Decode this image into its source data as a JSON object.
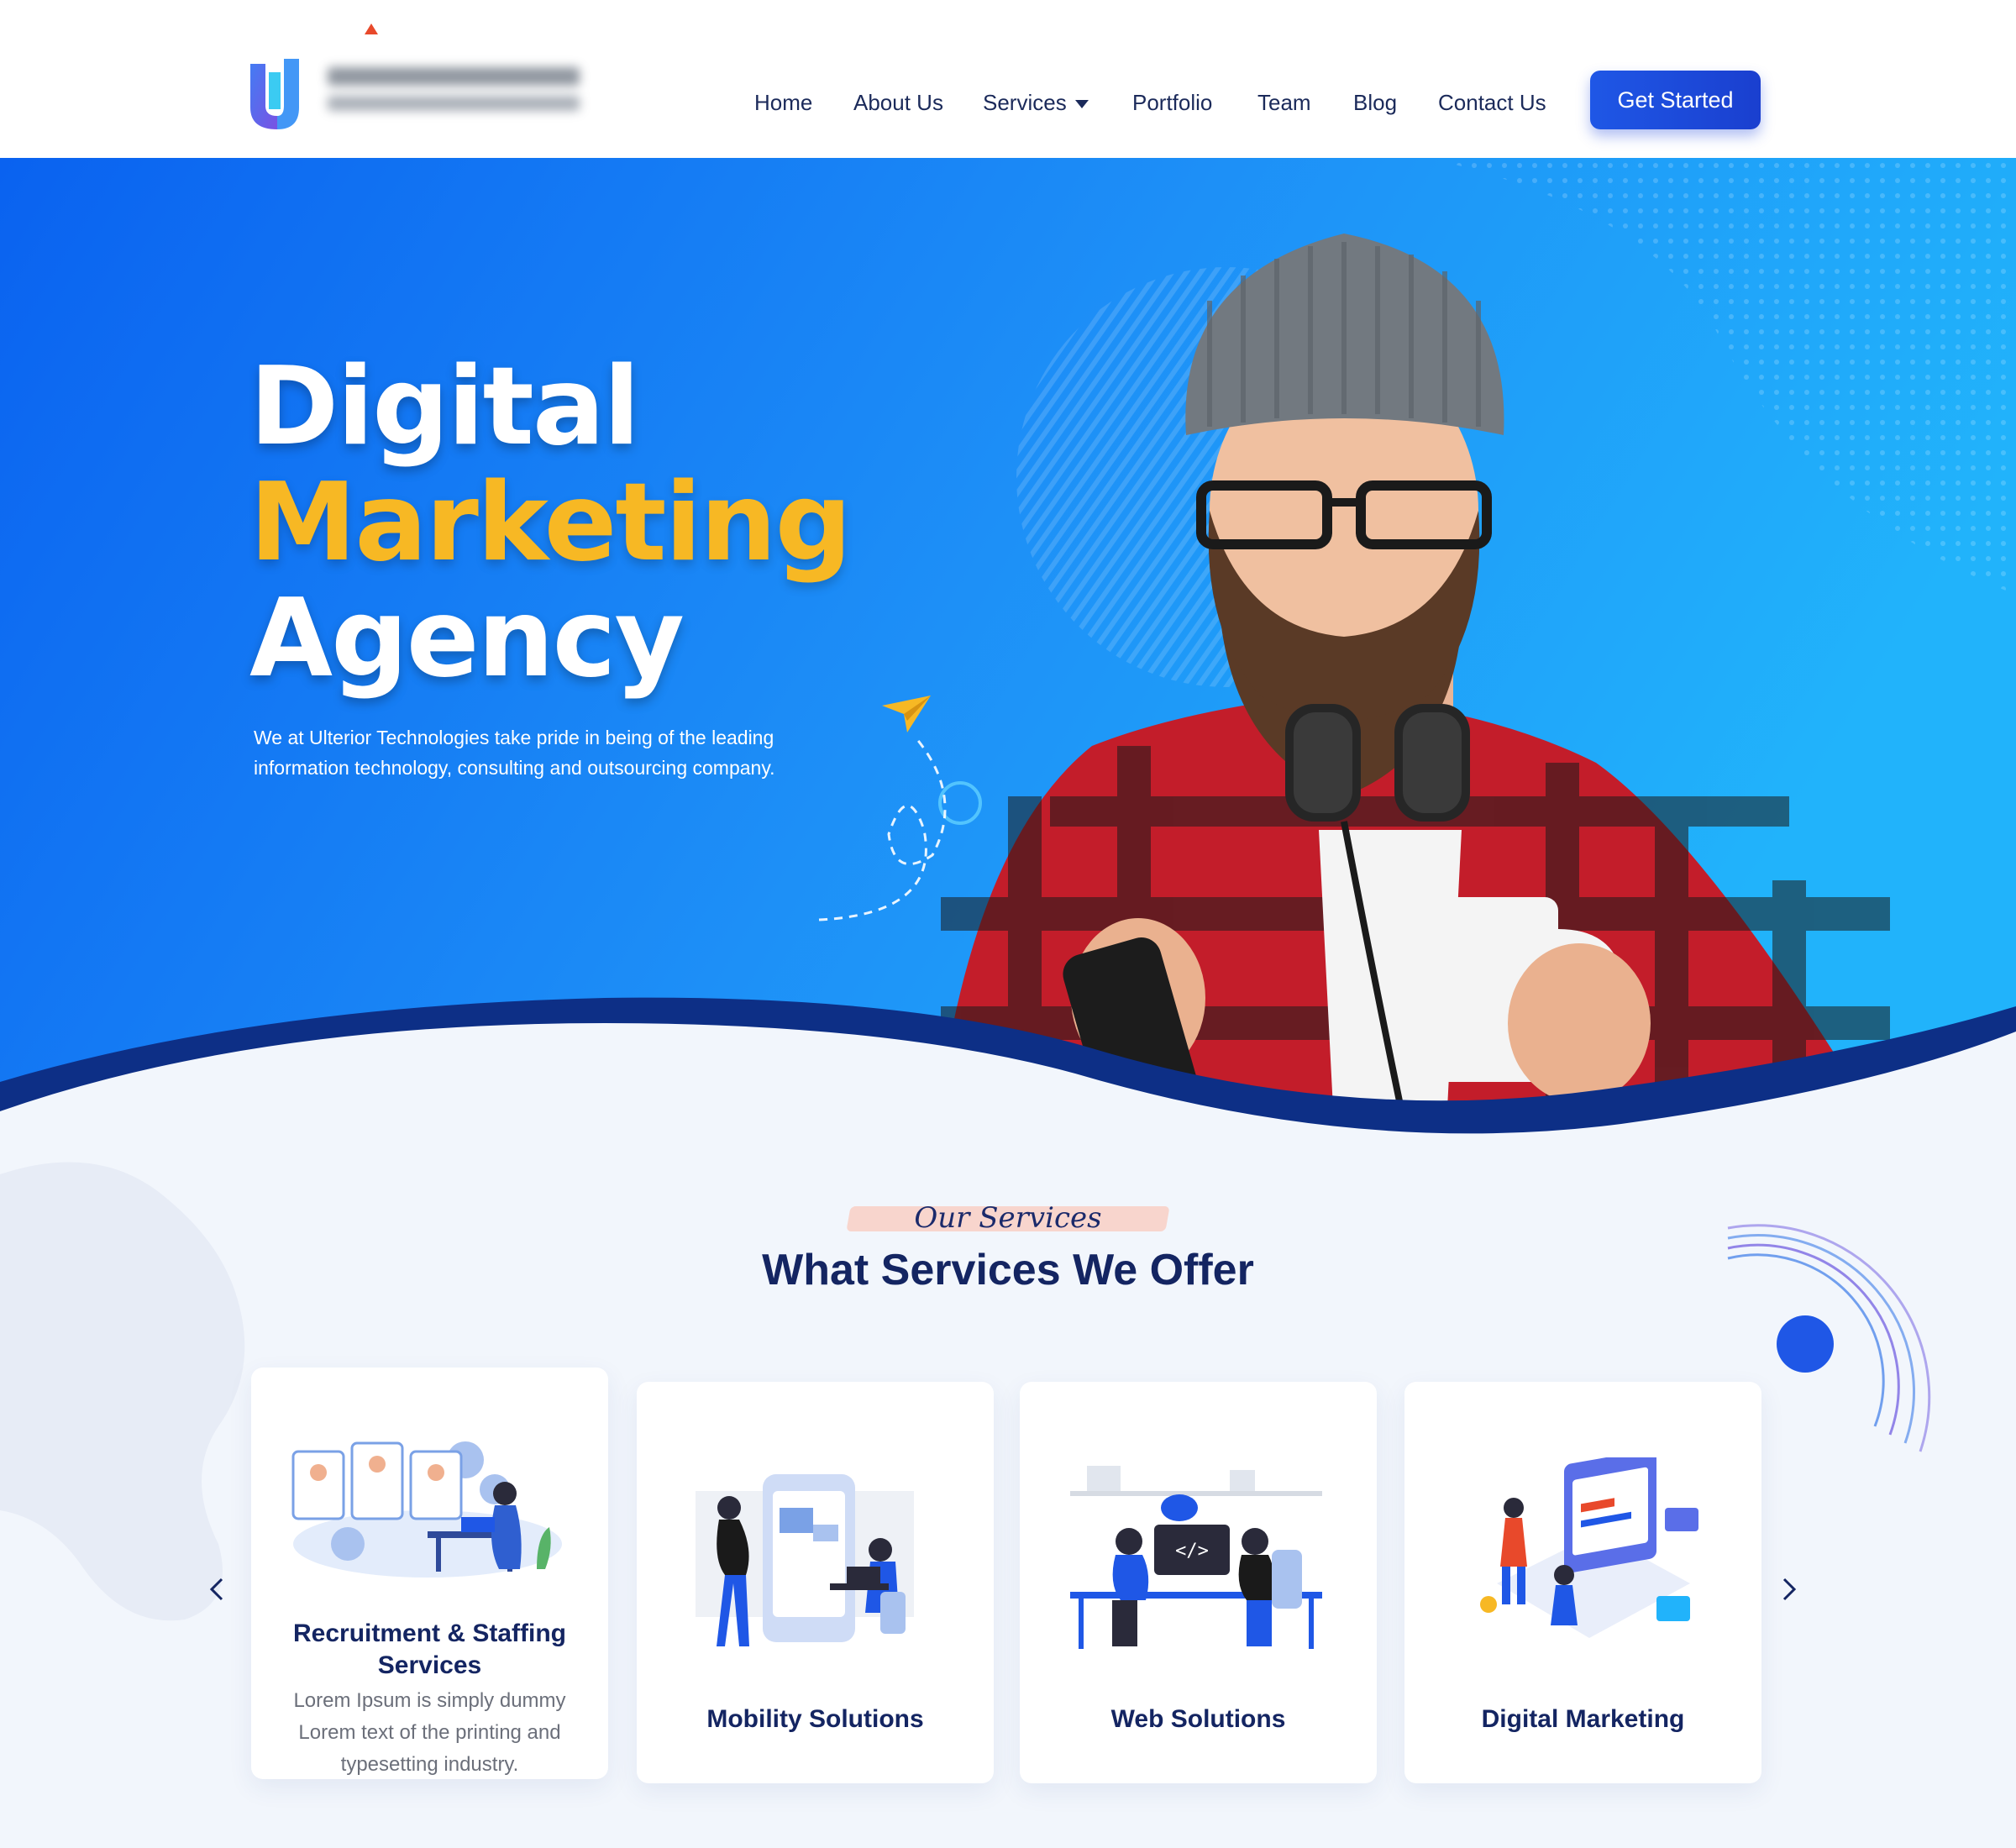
{
  "header": {
    "nav": [
      {
        "label": "Home"
      },
      {
        "label": "About Us"
      },
      {
        "label": "Services"
      },
      {
        "label": "Portfolio"
      },
      {
        "label": "Team"
      },
      {
        "label": "Blog"
      },
      {
        "label": "Contact Us"
      }
    ],
    "cta_label": "Get Started"
  },
  "hero": {
    "title_line1": "Digital",
    "title_line2": "Marketing",
    "title_line3": "Agency",
    "description": "We at Ulterior Technologies take pride in being of the leading information technology, consulting and outsourcing company."
  },
  "services": {
    "eyebrow": "Our Services",
    "title": "What Services We Offer",
    "cards": [
      {
        "title": "Recruitment & Staffing Services",
        "description": "Lorem Ipsum is simply dummy Lorem text of the printing and typesetting industry."
      },
      {
        "title": "Mobility Solutions"
      },
      {
        "title": "Web Solutions"
      },
      {
        "title": "Digital Marketing"
      }
    ]
  },
  "colors": {
    "brand_blue": "#1f57e6",
    "navy_text": "#142562",
    "accent_yellow": "#f7b824",
    "hero_blue": "#1a80f5"
  },
  "icons": [
    "logo-icon",
    "services-dropdown-icon",
    "paper-plane-icon",
    "chevron-left-icon",
    "chevron-right-icon"
  ]
}
